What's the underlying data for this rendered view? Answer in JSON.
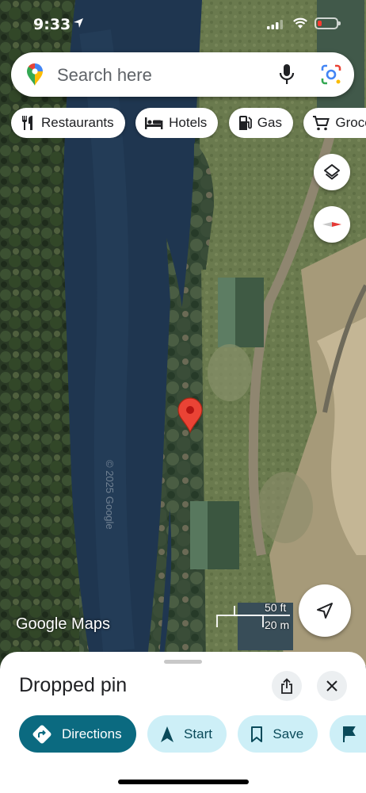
{
  "status_bar": {
    "time": "9:33"
  },
  "search": {
    "placeholder": "Search here"
  },
  "chips": [
    {
      "label": "Restaurants",
      "icon": "fork-knife-icon"
    },
    {
      "label": "Hotels",
      "icon": "bed-icon"
    },
    {
      "label": "Gas",
      "icon": "gas-pump-icon"
    },
    {
      "label": "Groceries",
      "icon": "cart-icon"
    }
  ],
  "map": {
    "watermark": "Google Maps",
    "copyright": "© 2025 Google",
    "scale": {
      "feet": "50 ft",
      "meters": "20 m"
    },
    "pin_color": "#ea4335"
  },
  "sheet": {
    "title": "Dropped pin",
    "actions": [
      {
        "label": "Directions",
        "icon": "directions-icon"
      },
      {
        "label": "Start",
        "icon": "navigation-arrow-icon"
      },
      {
        "label": "Save",
        "icon": "bookmark-icon"
      },
      {
        "label": "",
        "icon": "flag-icon"
      }
    ]
  },
  "colors": {
    "primary": "#0b6a80",
    "secondary": "#cdeff7"
  }
}
